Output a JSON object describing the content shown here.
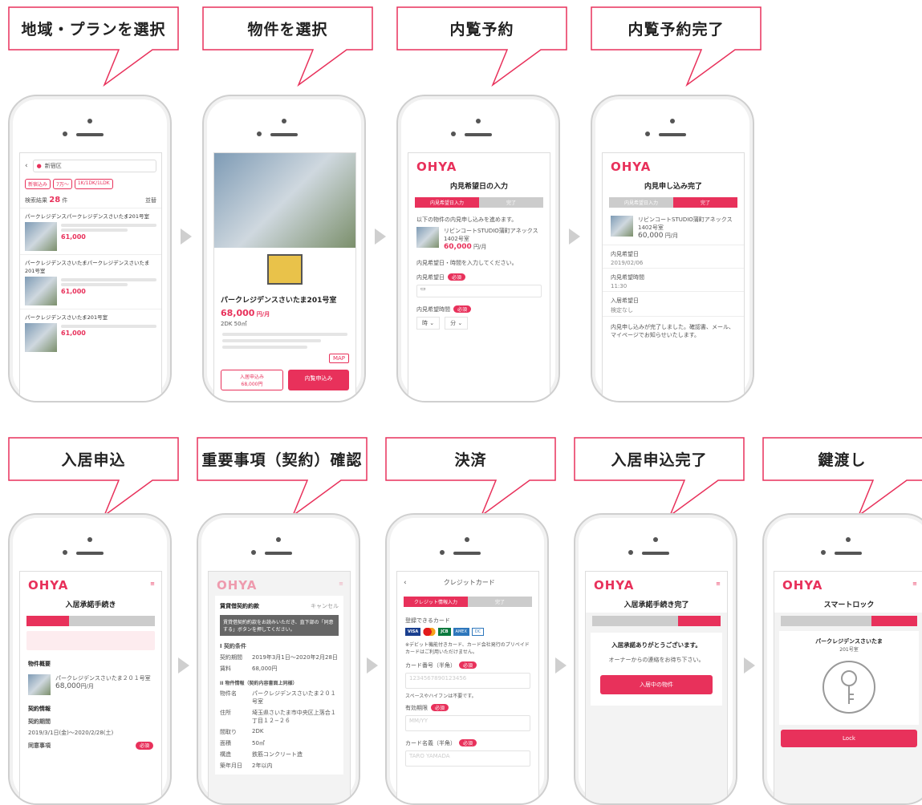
{
  "steps_top": [
    "地域・プランを選択",
    "物件を選択",
    "内覧予約",
    "内覧予約完了"
  ],
  "steps_bottom": [
    "入居申込",
    "重要事項（契約）確認",
    "決済",
    "入居申込完了",
    "鍵渡し"
  ],
  "brand": {
    "logo": "OHYA",
    "accent": "#e8315b",
    "callout_border": "#e8315b"
  },
  "s1": {
    "search": "新宿区",
    "chips": [
      "新宿込み",
      "7万〜",
      "1K/1DK/1LDK"
    ],
    "count_label": "検索結果",
    "count": "28",
    "count_unit": "件",
    "sort": "並替",
    "items": [
      {
        "title": "パークレジデンスパークレジデンスさいたま201号室",
        "price": "61,000"
      },
      {
        "title": "パークレジデンスさいたまパークレジデンスさいたま201号室",
        "price": "61,000"
      },
      {
        "title": "パークレジデンスさいたま201号室",
        "price": "61,000"
      }
    ]
  },
  "s2": {
    "title": "パークレジデンスさいたま201号室",
    "price": "68,000",
    "price_unit": "円/月",
    "spec": "2DK 50㎡",
    "btn_apply": "入居申込み",
    "btn_apply_price": "68,000円",
    "btn_view": "内覧申込み",
    "map": "MAP"
  },
  "s3": {
    "heading": "内見希望日の入力",
    "step1": "内見希望日入力",
    "step2": "完了",
    "intro": "以下の物件の内見申し込みを進めます。",
    "prop": "リビンコートSTUDIO蒲町アネックス 1402号室",
    "price": "60,000",
    "price_unit": "円/月",
    "note": "内見希望日・時間を入力してください。",
    "label_date": "内見希望日",
    "label_time": "内見希望時間",
    "req": "必須",
    "hh": "時",
    "mm": "分"
  },
  "s4": {
    "heading": "内見申し込み完了",
    "step1": "内見希望日入力",
    "step2": "完了",
    "prop": "リビンコートSTUDIO蒲町アネックス 1402号室",
    "price": "60,000",
    "price_unit": "円/月",
    "label_date": "内見希望日",
    "date": "2019/02/06",
    "label_time": "内見希望時間",
    "time": "11:30",
    "label_move": "入居希望日",
    "move": "検定なし",
    "done": "内見申し込みが完了しました。確認書、メール、マイページでお知らせいたします。"
  },
  "s5": {
    "heading": "入居承諾手続き",
    "section1": "物件概要",
    "prop": "パークレジデンスさいたま２０１号室",
    "price": "68,000",
    "price_unit": "円/月",
    "section2": "契約情報",
    "term_label": "契約期間",
    "term": "2019/3/1日(金)〜2020/2/28(土)",
    "consent": "同意事項"
  },
  "s6": {
    "title": "賃貸借契約約款",
    "cancel": "キャンセル",
    "notice": "賃貸借契約約款をお読みいただき、直下部の「同意する」ボタンを押してください。",
    "sec1": "I 契約条件",
    "term_label": "契約期間",
    "term": "2019年3月1日〜2020年2月28日",
    "rent_label": "賃料",
    "rent": "68,000円",
    "sec2": "II 物件情報（契約内容書面上同様）",
    "name_label": "物件名",
    "name": "パークレジデンスさいたま２０１号室",
    "addr_label": "住所",
    "addr": "埼玉県さいたま市中央区上落合１丁目１２−２６",
    "layout_label": "間取り",
    "layout": "2DK",
    "area_label": "面積",
    "area": "50㎡",
    "struct_label": "構造",
    "struct": "鉄筋コンクリート造",
    "period_label": "築年月日",
    "period": "2年以内"
  },
  "s7": {
    "title": "クレジットカード",
    "step1": "クレジット情報入力",
    "step2": "完了",
    "cards_label": "登録できるカード",
    "cards": [
      "VISA",
      "MC",
      "JCB",
      "AMEX",
      "DC"
    ],
    "cards_note": "※デビット機能付きカード、カード会社発行のプリペイドカードはご利用いただけません。",
    "num_label": "カード番号（半角）",
    "num_ph": "1234567890123456",
    "num_note": "スペースやハイフンは不要です。",
    "exp_label": "有効期限",
    "exp_ph": "MM/YY",
    "name_label": "カード名義（半角）",
    "name_ph": "TARO YAMADA",
    "req": "必須"
  },
  "s8": {
    "heading": "入居承諾手続き完了",
    "thanks": "入居承諾ありがとうございます。",
    "wait": "オーナーからの連絡をお待ち下さい。",
    "btn": "入居中の物件"
  },
  "s9": {
    "heading": "スマートロック",
    "prop": "パークレジデンスさいたま",
    "room": "201号室",
    "btn": "Lock"
  }
}
